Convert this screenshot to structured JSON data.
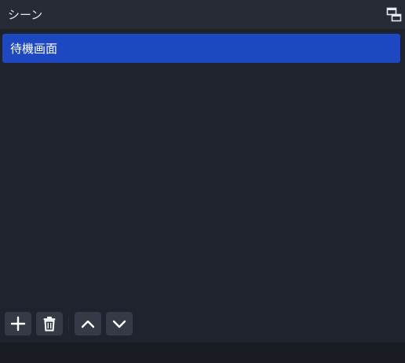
{
  "dock": {
    "title": "シーン"
  },
  "scenes": [
    {
      "label": "待機画面",
      "selected": true
    }
  ],
  "toolbar": {
    "buttons": [
      {
        "icon": "plus-icon",
        "action": "add-scene"
      },
      {
        "icon": "trash-icon",
        "action": "remove-scene"
      },
      {
        "icon": "chevron-up-icon",
        "action": "move-scene-up"
      },
      {
        "icon": "chevron-down-icon",
        "action": "move-scene-down"
      }
    ]
  },
  "colors": {
    "panel_bg": "#1f232d",
    "titlebar_bg": "#272b35",
    "selected_bg": "#1d48c2",
    "button_bg": "#353a46",
    "text": "#e6e8ee"
  }
}
